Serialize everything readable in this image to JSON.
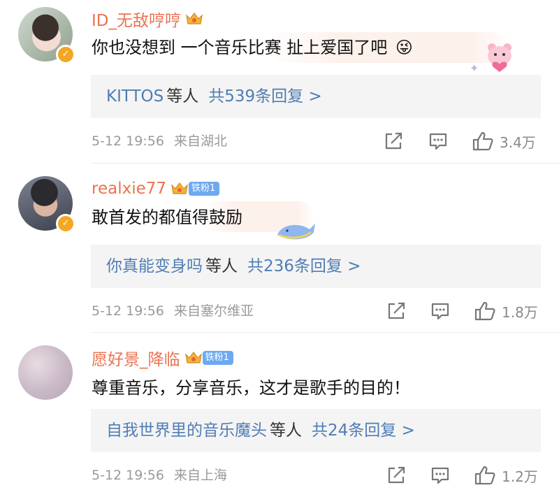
{
  "comments": [
    {
      "username": "ID_无敌哼哼",
      "fan_badge": "",
      "text": "你也没想到 一个音乐比赛 扯上爱国了吧",
      "emoji": "😜",
      "reply_users": "KITTOS",
      "reply_mid": "等人",
      "reply_count": "共539条回复 >",
      "time": "5-12 19:56",
      "location": "来自湖北",
      "likes": "3.4万"
    },
    {
      "username": "realxie77",
      "fan_badge": "铁粉1",
      "text": "敢首发的都值得鼓励",
      "emoji": "",
      "reply_users": "你真能变身吗",
      "reply_mid": "等人",
      "reply_count": "共236条回复 >",
      "time": "5-12 19:56",
      "location": "来自塞尔维亚",
      "likes": "1.8万"
    },
    {
      "username": "愿好景_降临",
      "fan_badge": "铁粉1",
      "text": "尊重音乐，分享音乐，这才是歌手的目的！",
      "emoji": "",
      "reply_users": "自我世界里的音乐魔头",
      "reply_mid": "等人",
      "reply_count": "共24条回复 >",
      "time": "5-12 19:56",
      "location": "来自上海",
      "likes": "1.2万"
    }
  ],
  "icons": {
    "share": "share-icon",
    "comment": "comment-icon",
    "like": "thumbs-up-icon",
    "verified": "verified-badge-icon",
    "crown": "crown-icon"
  },
  "colors": {
    "username": "#eb7350",
    "reply_link": "#4f7db3",
    "verified": "#f5a623",
    "fan_badge": "#6da9f0"
  }
}
